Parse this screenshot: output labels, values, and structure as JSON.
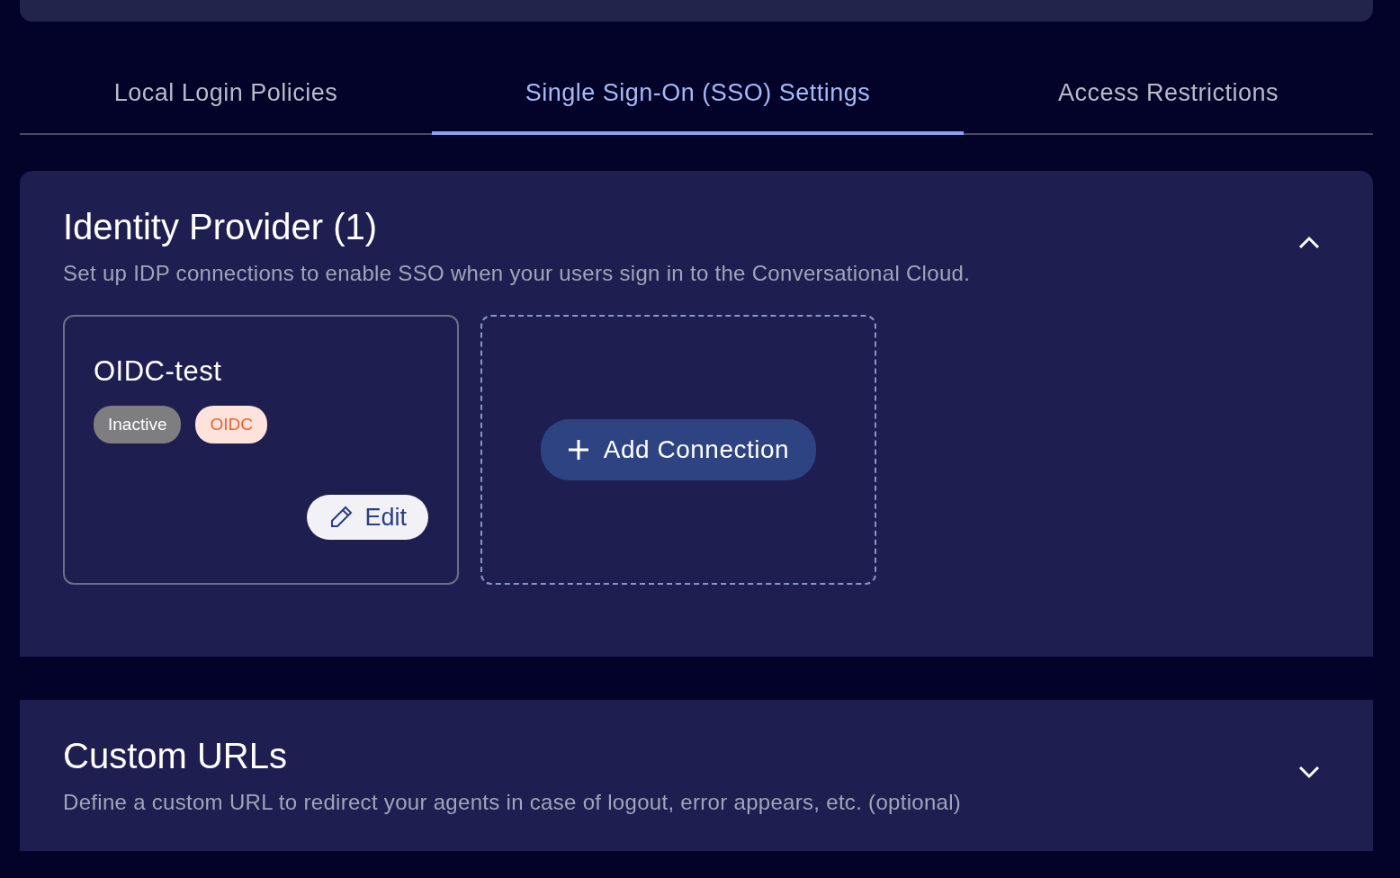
{
  "tabs": [
    {
      "label": "Local Login Policies",
      "selected": false
    },
    {
      "label": "Single Sign-On (SSO) Settings",
      "selected": true
    },
    {
      "label": "Access Restrictions",
      "selected": false
    }
  ],
  "sections": [
    {
      "title": "Identity Provider (1)",
      "description": "Set up IDP connections to enable SSO when your users sign in to the Conversational Cloud.",
      "expanded": true,
      "connections": [
        {
          "name": "OIDC-test",
          "status": "Inactive",
          "active": false,
          "protocol": "OIDC",
          "edit_label": "Edit"
        }
      ],
      "add_label": "Add Connection"
    },
    {
      "title": "Custom URLs",
      "description": "Define a custom URL to redirect your agents in case of logout, error appears, etc. (optional)",
      "expanded": false
    }
  ]
}
